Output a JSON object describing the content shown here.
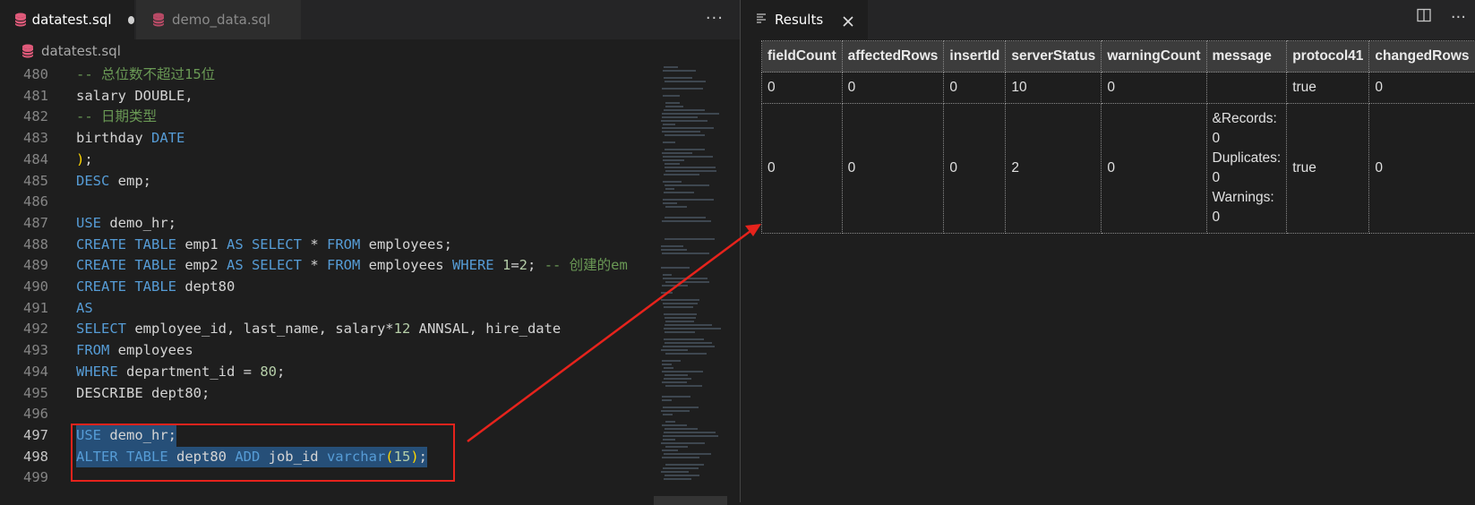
{
  "editor": {
    "tabs": [
      {
        "label": "datatest.sql",
        "active": true,
        "dirty": true
      },
      {
        "label": "demo_data.sql",
        "active": false,
        "dirty": false
      }
    ],
    "more_actions": "···",
    "breadcrumb": "datatest.sql",
    "lines": [
      {
        "num": "480",
        "segs": [
          [
            "c",
            "-- 总位数不超过15位"
          ]
        ]
      },
      {
        "num": "481",
        "segs": [
          [
            "t",
            "salary DOUBLE,"
          ]
        ]
      },
      {
        "num": "482",
        "segs": [
          [
            "c",
            "-- 日期类型"
          ]
        ]
      },
      {
        "num": "483",
        "segs": [
          [
            "t",
            "birthday "
          ],
          [
            "k",
            "DATE"
          ]
        ]
      },
      {
        "num": "484",
        "segs": [
          [
            "y",
            ")"
          ],
          [
            "t",
            ";"
          ]
        ]
      },
      {
        "num": "485",
        "segs": [
          [
            "k",
            "DESC"
          ],
          [
            "t",
            " emp;"
          ]
        ]
      },
      {
        "num": "486",
        "segs": []
      },
      {
        "num": "487",
        "segs": [
          [
            "k",
            "USE"
          ],
          [
            "t",
            " demo_hr;"
          ]
        ]
      },
      {
        "num": "488",
        "segs": [
          [
            "k",
            "CREATE TABLE"
          ],
          [
            "t",
            " emp1 "
          ],
          [
            "k",
            "AS SELECT"
          ],
          [
            "t",
            " * "
          ],
          [
            "k",
            "FROM"
          ],
          [
            "t",
            " employees;"
          ]
        ]
      },
      {
        "num": "489",
        "segs": [
          [
            "k",
            "CREATE TABLE"
          ],
          [
            "t",
            " emp2 "
          ],
          [
            "k",
            "AS SELECT"
          ],
          [
            "t",
            " * "
          ],
          [
            "k",
            "FROM"
          ],
          [
            "t",
            " employees "
          ],
          [
            "k",
            "WHERE"
          ],
          [
            "t",
            " "
          ],
          [
            "n",
            "1"
          ],
          [
            "t",
            "="
          ],
          [
            "n",
            "2"
          ],
          [
            "t",
            "; "
          ],
          [
            "c",
            "-- 创建的em"
          ]
        ]
      },
      {
        "num": "490",
        "segs": [
          [
            "k",
            "CREATE TABLE"
          ],
          [
            "t",
            " dept80"
          ]
        ]
      },
      {
        "num": "491",
        "segs": [
          [
            "k",
            "AS"
          ]
        ]
      },
      {
        "num": "492",
        "segs": [
          [
            "k",
            "SELECT"
          ],
          [
            "t",
            " employee_id, last_name, salary*"
          ],
          [
            "n",
            "12"
          ],
          [
            "t",
            " ANNSAL, hire_date"
          ]
        ]
      },
      {
        "num": "493",
        "segs": [
          [
            "k",
            "FROM"
          ],
          [
            "t",
            " employees"
          ]
        ]
      },
      {
        "num": "494",
        "segs": [
          [
            "k",
            "WHERE"
          ],
          [
            "t",
            " department_id = "
          ],
          [
            "n",
            "80"
          ],
          [
            "t",
            ";"
          ]
        ]
      },
      {
        "num": "495",
        "segs": [
          [
            "t",
            "DESCRIBE dept80;"
          ]
        ]
      },
      {
        "num": "496",
        "segs": []
      },
      {
        "num": "497",
        "sel": true,
        "segs": [
          [
            "k",
            "USE"
          ],
          [
            "t",
            " demo_hr;"
          ]
        ]
      },
      {
        "num": "498",
        "sel": true,
        "segs": [
          [
            "k",
            "ALTER TABLE"
          ],
          [
            "t",
            " dept80 "
          ],
          [
            "k",
            "ADD"
          ],
          [
            "t",
            " job_id "
          ],
          [
            "k",
            "varchar"
          ],
          [
            "y",
            "("
          ],
          [
            "n",
            "15"
          ],
          [
            "y",
            ")"
          ],
          [
            "t",
            ";"
          ]
        ]
      },
      {
        "num": "499",
        "segs": []
      }
    ]
  },
  "results": {
    "tab_label": "Results",
    "columns": [
      "fieldCount",
      "affectedRows",
      "insertId",
      "serverStatus",
      "warningCount",
      "message",
      "protocol41",
      "changedRows"
    ],
    "rows": [
      [
        "0",
        "0",
        "0",
        "10",
        "0",
        "",
        "true",
        "0"
      ],
      [
        "0",
        "0",
        "0",
        "2",
        "0",
        [
          "&Records:",
          "0",
          "Duplicates:",
          "0",
          "Warnings:",
          "0"
        ],
        "true",
        "0"
      ]
    ]
  },
  "colors": {
    "keyword": "#569cd6",
    "comment": "#6a9955",
    "number": "#b5cea8",
    "bracket": "#ffd700",
    "annotation": "#e6231c",
    "file_icon": "#e05a7a"
  }
}
